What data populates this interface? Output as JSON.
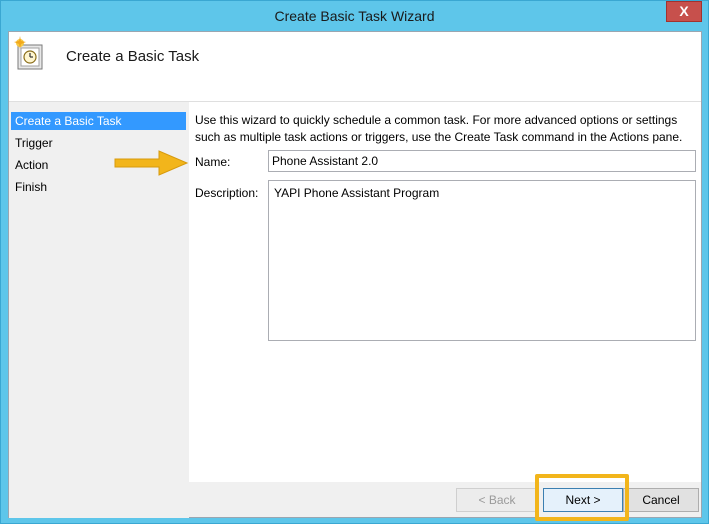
{
  "window": {
    "title": "Create Basic Task Wizard",
    "close_glyph": "X"
  },
  "header": {
    "title": "Create a Basic Task",
    "icon": "clock-task-icon"
  },
  "steps": [
    {
      "label": "Create a Basic Task",
      "active": true
    },
    {
      "label": "Trigger",
      "active": false
    },
    {
      "label": "Action",
      "active": false
    },
    {
      "label": "Finish",
      "active": false
    }
  ],
  "main": {
    "intro_line1": "Use this wizard to quickly schedule a common task.  For more advanced options or settings",
    "intro_line2": "such as multiple task actions or triggers, use the Create Task command in the Actions pane.",
    "name_label": "Name:",
    "name_value": "Phone Assistant 2.0",
    "description_label": "Description:",
    "description_value": "YAPI Phone Assistant Program"
  },
  "buttons": {
    "back": "< Back",
    "next": "Next >",
    "cancel": "Cancel"
  },
  "annotations": {
    "arrow_color": "#f2b51b",
    "highlight_color": "#f2b51b"
  },
  "colors": {
    "titlebar": "#5ec6ea",
    "selection": "#3399ff",
    "close_button": "#c7504c"
  }
}
